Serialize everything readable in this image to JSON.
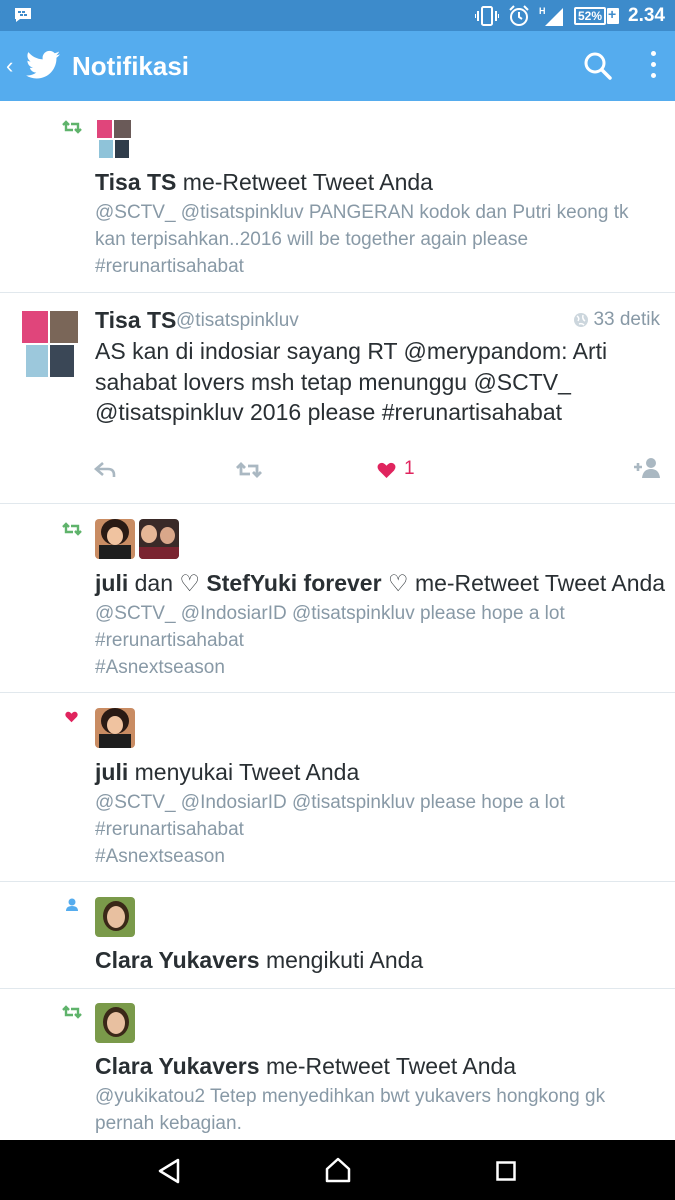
{
  "status_bar": {
    "time": "2.34",
    "battery": "52%",
    "network": "H",
    "icons": [
      "bbm-notification-icon",
      "vibrate-icon",
      "alarm-icon",
      "signal-icon",
      "battery-icon"
    ]
  },
  "app_bar": {
    "title": "Notifikasi",
    "icons": [
      "back-icon",
      "twitter-bird-icon",
      "search-icon",
      "more-vert-icon"
    ]
  },
  "notifications": [
    {
      "type": "retweet",
      "name": "Tisa TS",
      "action": "me-Retweet Tweet Anda",
      "snippet": "@SCTV_ @tisatspinkluv PANGERAN kodok dan Putri keong tk kan terpisahkan..2016 will be together again please #rerunartisahabat"
    },
    {
      "type": "tweet",
      "name": "Tisa TS",
      "handle": "@tisatspinkluv",
      "time": "33 detik",
      "text": "AS kan di indosiar sayang RT @merypandom: Arti sahabat lovers msh tetap menunggu @SCTV_ @tisatspinkluv 2016 please #rerunartisahabat",
      "like_count": "1"
    },
    {
      "type": "retweet",
      "name": "juli",
      "connector": "dan",
      "name2": "♡ StefYuki forever ♡",
      "action": "me-Retweet Tweet Anda",
      "snippet_lines": [
        "@SCTV_ @IndosiarID @tisatspinkluv please hope a lot",
        "#rerunartisahabat",
        "#Asnextseason"
      ]
    },
    {
      "type": "like",
      "name": "juli",
      "action": "menyukai Tweet Anda",
      "snippet_lines": [
        "@SCTV_ @IndosiarID @tisatspinkluv please hope a lot",
        "#rerunartisahabat",
        "#Asnextseason"
      ]
    },
    {
      "type": "follow",
      "name": "Clara Yukavers",
      "action": "mengikuti Anda"
    },
    {
      "type": "retweet",
      "name": "Clara Yukavers",
      "action": "me-Retweet Tweet Anda",
      "snippet": "@yukikatou2 Tetep menyedihkan bwt yukavers hongkong gk pernah kebagian."
    }
  ],
  "colors": {
    "status_bar": "#3d8bcb",
    "app_bar": "#55acee",
    "retweet_green": "#5fb36b",
    "like_red": "#e0245e",
    "follow_blue": "#55acee",
    "muted_text": "#8899a6"
  }
}
